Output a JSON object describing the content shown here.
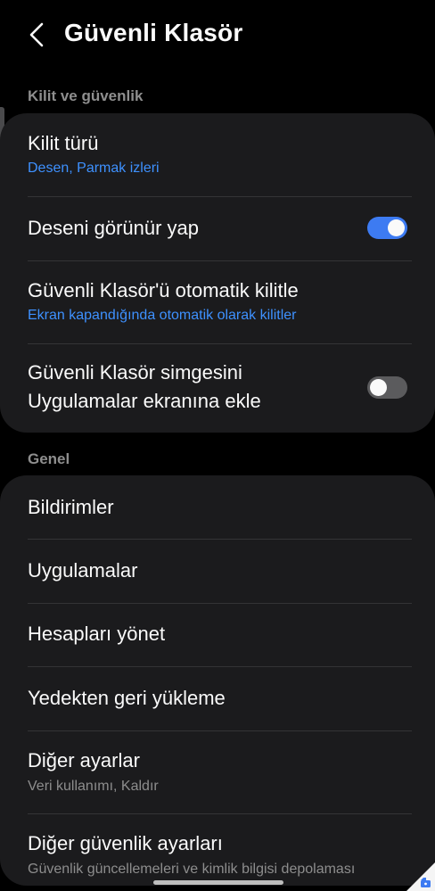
{
  "header": {
    "title": "Güvenli Klasör"
  },
  "sections": {
    "lock": {
      "label": "Kilit ve güvenlik",
      "lock_type": {
        "title": "Kilit türü",
        "subtitle": "Desen, Parmak izleri"
      },
      "show_pattern": {
        "title": "Deseni görünür yap",
        "enabled": true
      },
      "auto_lock": {
        "title": "Güvenli Klasör'ü otomatik kilitle",
        "subtitle": "Ekran kapandığında otomatik olarak kilitler"
      },
      "add_icon": {
        "title_line1": "Güvenli Klasör simgesini",
        "title_line2": "Uygulamalar ekranına ekle",
        "enabled": false
      }
    },
    "general": {
      "label": "Genel",
      "notifications": {
        "title": "Bildirimler"
      },
      "apps": {
        "title": "Uygulamalar"
      },
      "accounts": {
        "title": "Hesapları yönet"
      },
      "restore": {
        "title": "Yedekten geri yükleme"
      },
      "other_settings": {
        "title": "Diğer ayarlar",
        "subtitle": "Veri kullanımı, Kaldır"
      },
      "other_security": {
        "title": "Diğer güvenlik ayarları",
        "subtitle": "Güvenlik güncellemeleri ve kimlik bilgisi depolaması"
      }
    }
  },
  "colors": {
    "accent": "#3d7bf2",
    "link": "#3e91ff",
    "card": "#1b1b1d",
    "background": "#000000"
  },
  "icons": [
    "back-arrow-icon",
    "secure-folder-icon"
  ]
}
